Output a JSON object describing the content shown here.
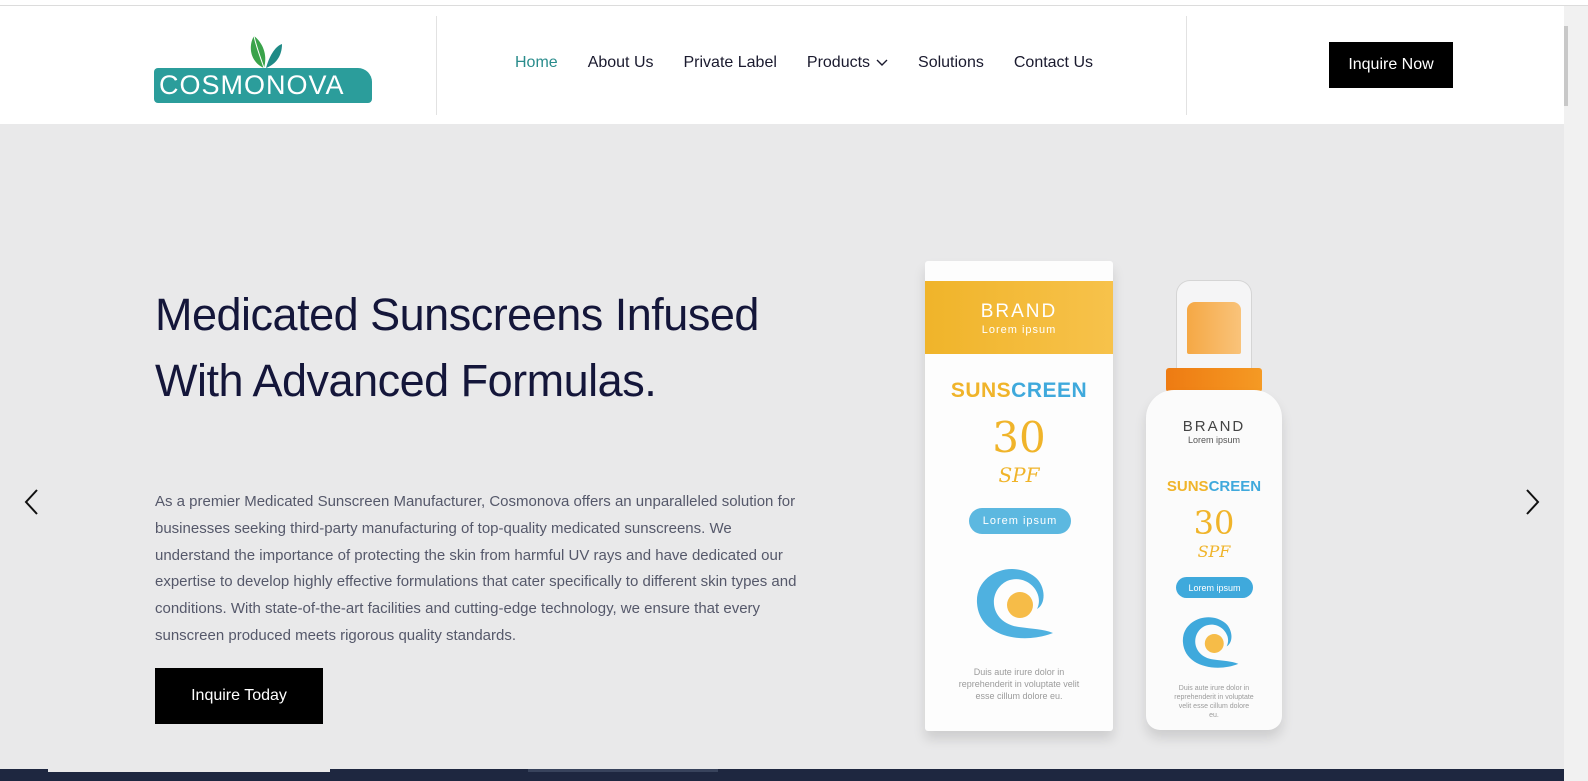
{
  "brand": {
    "logo_text": "COSMONOVA"
  },
  "nav": {
    "items": [
      {
        "label": "Home",
        "active": true
      },
      {
        "label": "About Us"
      },
      {
        "label": "Private Label"
      },
      {
        "label": "Products",
        "has_dropdown": true
      },
      {
        "label": "Solutions"
      },
      {
        "label": "Contact Us"
      }
    ],
    "cta": "Inquire Now"
  },
  "hero": {
    "title": "Medicated Sunscreens Infused With Advanced Formulas.",
    "description": "As a premier Medicated Sunscreen Manufacturer, Cosmonova offers an unparalleled solution for businesses seeking third-party manufacturing of top-quality medicated sunscreens. We understand the importance of protecting the skin from harmful UV rays and have dedicated our expertise to develop highly effective formulations that cater specifically to different skin types and conditions. With state-of-the-art facilities and cutting-edge technology, we ensure that every sunscreen produced meets rigorous quality standards.",
    "cta": "Inquire Today"
  },
  "product_image": {
    "box": {
      "brand": "BRAND",
      "brand_sub": "Lorem ipsum",
      "title_a": "SUNS",
      "title_b": "CREEN",
      "spf_number": "30",
      "spf_label": "SPF",
      "pill": "Lorem ipsum",
      "fine_print": "Duis aute irure dolor in reprehenderit in voluptate velit esse cillum dolore eu."
    },
    "bottle": {
      "brand": "BRAND",
      "brand_sub": "Lorem ipsum",
      "title_a": "SUNS",
      "title_b": "CREEN",
      "spf_number": "30",
      "spf_label": "SPF",
      "pill": "Lorem ipsum",
      "fine_print": "Duis aute irure dolor in reprehenderit in voluptate velit esse cillum dolore eu."
    }
  },
  "colors": {
    "accent_teal": "#2b9d9b",
    "nav_active": "#2a8c8c",
    "heading": "#14163a",
    "cta_bg": "#000000",
    "sun_orange": "#f0b42a",
    "sun_blue": "#3fa9dc"
  },
  "icons": {
    "leaf": "leaf-icon",
    "prev": "chevron-left-icon",
    "next": "chevron-right-icon",
    "dropdown": "chevron-down-icon"
  }
}
